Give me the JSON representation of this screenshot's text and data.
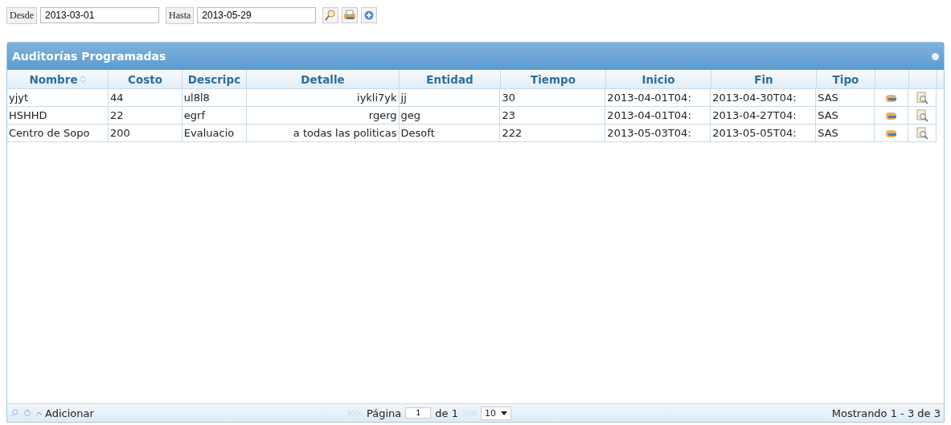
{
  "filter": {
    "from_label": "Desde",
    "from_value": "2013-03-01",
    "to_label": "Hasta",
    "to_value": "2013-05-29"
  },
  "grid": {
    "title": "Auditorías Programadas",
    "columns": [
      {
        "label": "Nombre",
        "sorted": true
      },
      {
        "label": "Costo",
        "sorted": false
      },
      {
        "label": "Descripc",
        "sorted": false
      },
      {
        "label": "Detalle",
        "sorted": false
      },
      {
        "label": "Entidad",
        "sorted": false
      },
      {
        "label": "Tiempo",
        "sorted": false
      },
      {
        "label": "Inicio",
        "sorted": false
      },
      {
        "label": "Fin",
        "sorted": false
      },
      {
        "label": "Tipo",
        "sorted": false
      }
    ],
    "rows": [
      {
        "cells": [
          "yjyt",
          "44",
          "ul8l8",
          "iykli7yk",
          "jj",
          "30",
          "2013-04-01T04:",
          "2013-04-30T04:",
          "SAS"
        ]
      },
      {
        "cells": [
          "HSHHD",
          "22",
          "egrf",
          "rgerg",
          "geg",
          "23",
          "2013-04-01T04:",
          "2013-04-27T04:",
          "SAS"
        ]
      },
      {
        "cells": [
          "Centro de Sopo",
          "200",
          "Evaluacio",
          "a todas las politicas",
          "Desoft",
          "222",
          "2013-05-03T04:",
          "2013-05-05T04:",
          "SAS"
        ]
      }
    ]
  },
  "footer": {
    "add_label": "Adicionar",
    "page_label": "Página",
    "page_value": "1",
    "of_label": "de 1",
    "page_size": "10",
    "summary": "Mostrando 1 - 3 de 3"
  }
}
